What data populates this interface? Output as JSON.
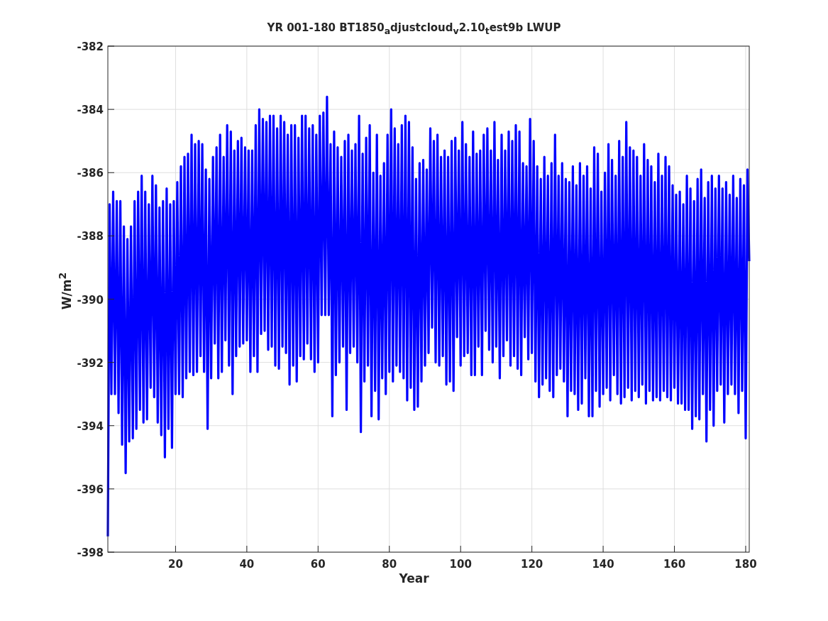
{
  "figure": {
    "chart_data": {
      "type": "line",
      "title": "YR 001-180 BT1850$_{a}$djustcloud$_{v}$2.10$_{t}$est9b LWUP",
      "xlabel": "Year",
      "ylabel": "W/m$^{2}$",
      "xlim": [
        1,
        181
      ],
      "ylim": [
        -398,
        -382
      ],
      "xticks": [
        20,
        40,
        60,
        80,
        100,
        120,
        140,
        160,
        180
      ],
      "yticks": [
        -398,
        -396,
        -394,
        -392,
        -390,
        -388,
        -386,
        -384,
        -382
      ],
      "grid": true,
      "x": [
        1,
        1.5,
        2,
        2.5,
        3,
        3.5,
        4,
        4.5,
        5,
        5.5,
        6,
        6.5,
        7,
        7.5,
        8,
        8.5,
        9,
        9.5,
        10,
        10.5,
        11,
        11.5,
        12,
        12.5,
        13,
        13.5,
        14,
        14.5,
        15,
        15.5,
        16,
        16.5,
        17,
        17.5,
        18,
        18.5,
        19,
        19.5,
        20,
        20.5,
        21,
        21.5,
        22,
        22.5,
        23,
        23.5,
        24,
        24.5,
        25,
        25.5,
        26,
        26.5,
        27,
        27.5,
        28,
        28.5,
        29,
        29.5,
        30,
        30.5,
        31,
        31.5,
        32,
        32.5,
        33,
        33.5,
        34,
        34.5,
        35,
        35.5,
        36,
        36.5,
        37,
        37.5,
        38,
        38.5,
        39,
        39.5,
        40,
        40.5,
        41,
        41.5,
        42,
        42.5,
        43,
        43.5,
        44,
        44.5,
        45,
        45.5,
        46,
        46.5,
        47,
        47.5,
        48,
        48.5,
        49,
        49.5,
        50,
        50.5,
        51,
        51.5,
        52,
        52.5,
        53,
        53.5,
        54,
        54.5,
        55,
        55.5,
        56,
        56.5,
        57,
        57.5,
        58,
        58.5,
        59,
        59.5,
        60,
        60.5,
        61,
        61.5,
        62,
        62.5,
        63,
        63.5,
        64,
        64.5,
        65,
        65.5,
        66,
        66.5,
        67,
        67.5,
        68,
        68.5,
        69,
        69.5,
        70,
        70.5,
        71,
        71.5,
        72,
        72.5,
        73,
        73.5,
        74,
        74.5,
        75,
        75.5,
        76,
        76.5,
        77,
        77.5,
        78,
        78.5,
        79,
        79.5,
        80,
        80.5,
        81,
        81.5,
        82,
        82.5,
        83,
        83.5,
        84,
        84.5,
        85,
        85.5,
        86,
        86.5,
        87,
        87.5,
        88,
        88.5,
        89,
        89.5,
        90,
        90.5,
        91,
        91.5,
        92,
        92.5,
        93,
        93.5,
        94,
        94.5,
        95,
        95.5,
        96,
        96.5,
        97,
        97.5,
        98,
        98.5,
        99,
        99.5,
        100,
        100.5,
        101,
        101.5,
        102,
        102.5,
        103,
        103.5,
        104,
        104.5,
        105,
        105.5,
        106,
        106.5,
        107,
        107.5,
        108,
        108.5,
        109,
        109.5,
        110,
        110.5,
        111,
        111.5,
        112,
        112.5,
        113,
        113.5,
        114,
        114.5,
        115,
        115.5,
        116,
        116.5,
        117,
        117.5,
        118,
        118.5,
        119,
        119.5,
        120,
        120.5,
        121,
        121.5,
        122,
        122.5,
        123,
        123.5,
        124,
        124.5,
        125,
        125.5,
        126,
        126.5,
        127,
        127.5,
        128,
        128.5,
        129,
        129.5,
        130,
        130.5,
        131,
        131.5,
        132,
        132.5,
        133,
        133.5,
        134,
        134.5,
        135,
        135.5,
        136,
        136.5,
        137,
        137.5,
        138,
        138.5,
        139,
        139.5,
        140,
        140.5,
        141,
        141.5,
        142,
        142.5,
        143,
        143.5,
        144,
        144.5,
        145,
        145.5,
        146,
        146.5,
        147,
        147.5,
        148,
        148.5,
        149,
        149.5,
        150,
        150.5,
        151,
        151.5,
        152,
        152.5,
        153,
        153.5,
        154,
        154.5,
        155,
        155.5,
        156,
        156.5,
        157,
        157.5,
        158,
        158.5,
        159,
        159.5,
        160,
        160.5,
        161,
        161.5,
        162,
        162.5,
        163,
        163.5,
        164,
        164.5,
        165,
        165.5,
        166,
        166.5,
        167,
        167.5,
        168,
        168.5,
        169,
        169.5,
        170,
        170.5,
        171,
        171.5,
        172,
        172.5,
        173,
        173.5,
        174,
        174.5,
        175,
        175.5,
        176,
        176.5,
        177,
        177.5,
        178,
        178.5,
        179,
        179.5,
        180,
        180.5,
        181
      ],
      "series": [
        {
          "color": "#0000ff",
          "values": [
            -397.5,
            -387,
            -393,
            -386.6,
            -393,
            -386.9,
            -393.6,
            -386.9,
            -394.6,
            -387.7,
            -395.5,
            -388.1,
            -394.5,
            -387.7,
            -394.4,
            -386.9,
            -394.1,
            -386.6,
            -393.5,
            -386.1,
            -393.9,
            -386.6,
            -393.8,
            -387,
            -392.8,
            -386.1,
            -393.1,
            -386.4,
            -393.9,
            -387.1,
            -394.3,
            -386.9,
            -395,
            -386.5,
            -394.1,
            -387,
            -394.7,
            -386.9,
            -393,
            -386.3,
            -393,
            -385.8,
            -393.1,
            -385.5,
            -392.5,
            -385.4,
            -392.3,
            -384.8,
            -392.4,
            -385.1,
            -392.3,
            -385,
            -391.8,
            -385.1,
            -392.3,
            -385.9,
            -394.1,
            -386.2,
            -392.5,
            -385.5,
            -391.4,
            -385.2,
            -392.5,
            -384.8,
            -392.3,
            -385.5,
            -391.3,
            -384.5,
            -392.1,
            -384.7,
            -393,
            -385.3,
            -391.8,
            -385,
            -391.5,
            -384.9,
            -391.4,
            -385.2,
            -391.3,
            -385.3,
            -392.3,
            -385.3,
            -391.8,
            -384.5,
            -392.3,
            -384,
            -391.1,
            -384.3,
            -391,
            -384.4,
            -391.6,
            -384.2,
            -391.5,
            -384.2,
            -392.1,
            -384.6,
            -392.2,
            -384.2,
            -391.5,
            -384.4,
            -391.7,
            -384.8,
            -392.7,
            -384.5,
            -392.1,
            -384.5,
            -392.6,
            -384.9,
            -391.8,
            -384.2,
            -391.9,
            -384.2,
            -391.4,
            -384.6,
            -391.9,
            -384.5,
            -392.3,
            -384.8,
            -392,
            -384.2,
            -390.5,
            -384.1,
            -390.5,
            -383.6,
            -390.5,
            -385.1,
            -393.7,
            -384.7,
            -392.4,
            -385.2,
            -392,
            -385.5,
            -391.5,
            -385,
            -393.5,
            -384.8,
            -391.7,
            -385.3,
            -391.5,
            -385.1,
            -392,
            -384.2,
            -394.2,
            -385.4,
            -392.6,
            -384.9,
            -392.1,
            -384.5,
            -393.7,
            -386,
            -392.9,
            -384.8,
            -393.8,
            -386.1,
            -392.5,
            -385.7,
            -393,
            -384.8,
            -392.3,
            -384,
            -392.6,
            -384.6,
            -392.1,
            -385.1,
            -392.3,
            -384.5,
            -392.5,
            -384.2,
            -393.2,
            -384.4,
            -392.8,
            -385.2,
            -393.5,
            -386.2,
            -393.4,
            -385.7,
            -392.6,
            -385.6,
            -392.1,
            -385.9,
            -391.7,
            -384.6,
            -390.9,
            -385,
            -392,
            -384.8,
            -392.1,
            -385.5,
            -391.8,
            -385.3,
            -392.7,
            -385.5,
            -392.6,
            -385,
            -392.9,
            -384.9,
            -391.2,
            -385.3,
            -392.1,
            -384.4,
            -391.8,
            -385.1,
            -391.7,
            -385.5,
            -392.4,
            -384.7,
            -392.4,
            -385.4,
            -391.5,
            -385.3,
            -392.4,
            -384.8,
            -391,
            -384.6,
            -391.6,
            -385.3,
            -392,
            -384.4,
            -391.5,
            -385.6,
            -392.5,
            -384.8,
            -391.8,
            -385.3,
            -391.3,
            -384.7,
            -392.1,
            -385,
            -391.8,
            -384.5,
            -392.2,
            -384.7,
            -392.4,
            -385.7,
            -391.2,
            -385.8,
            -391.9,
            -384.3,
            -391.7,
            -385,
            -392.6,
            -385.8,
            -393.1,
            -386.2,
            -392.7,
            -385.5,
            -392.5,
            -386.1,
            -392.9,
            -385.7,
            -393.1,
            -384.8,
            -392.4,
            -386.1,
            -392.2,
            -385.7,
            -392.6,
            -386.2,
            -393.7,
            -386.3,
            -392.9,
            -385.8,
            -393,
            -386.4,
            -393.5,
            -385.7,
            -393.3,
            -386.1,
            -392.5,
            -385.8,
            -393.7,
            -386.5,
            -393.7,
            -385.2,
            -392.9,
            -385.4,
            -393.4,
            -386.6,
            -393,
            -386,
            -392.8,
            -385.1,
            -393.2,
            -385.6,
            -392.4,
            -386.1,
            -393,
            -385,
            -393.3,
            -385.5,
            -393.1,
            -384.4,
            -392.8,
            -385.2,
            -393.2,
            -385.3,
            -392.9,
            -385.5,
            -393.1,
            -386.1,
            -392.7,
            -385.1,
            -393.3,
            -385.6,
            -392.9,
            -385.8,
            -393.2,
            -386.3,
            -393.1,
            -385.4,
            -393.2,
            -386.1,
            -392.9,
            -385.5,
            -393.1,
            -385.8,
            -393.2,
            -386.4,
            -392.8,
            -386.7,
            -393.3,
            -386.6,
            -393.3,
            -387,
            -393.5,
            -386.1,
            -393.5,
            -386.5,
            -394.1,
            -386.9,
            -393.7,
            -386.2,
            -393.8,
            -385.9,
            -393,
            -386.8,
            -394.5,
            -386.3,
            -393.5,
            -386.1,
            -394,
            -386.5,
            -392.9,
            -386.1,
            -392.7,
            -386.5,
            -393.9,
            -386.3,
            -393,
            -386.7,
            -392.7,
            -386.1,
            -393,
            -386.8,
            -393.6,
            -386.2,
            -392.9,
            -386.4,
            -394.4,
            -385.9,
            -388.8
          ]
        }
      ]
    }
  }
}
